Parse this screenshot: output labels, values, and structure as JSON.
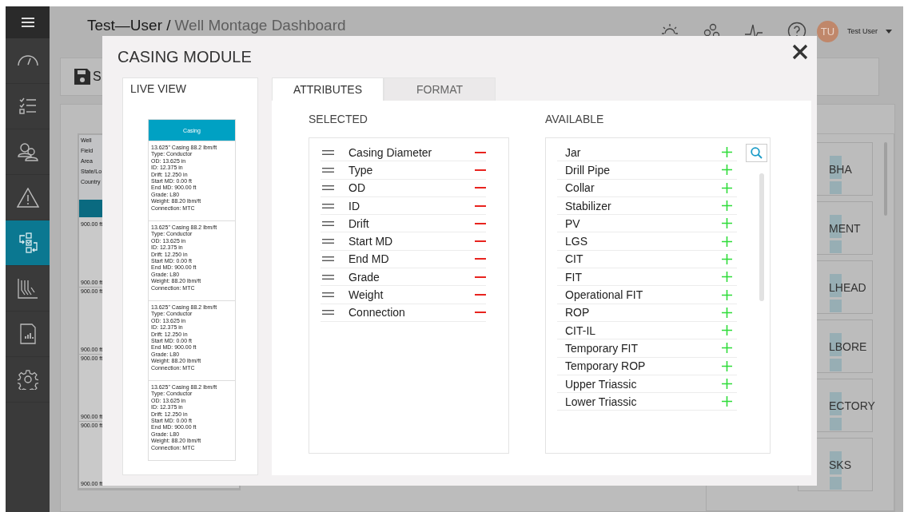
{
  "sidebar": {
    "items": [
      {
        "selected": false
      },
      {
        "selected": false
      },
      {
        "selected": false
      },
      {
        "selected": false
      },
      {
        "selected": true
      },
      {
        "selected": false
      },
      {
        "selected": false
      },
      {
        "selected": false
      }
    ]
  },
  "header": {
    "user": "Test—User /",
    "page": "Well Montage Dashboard",
    "avatar_initials": "TU",
    "user_name": "Test User"
  },
  "toolbar": {
    "save_label": "S"
  },
  "well_info_labels": [
    "Well",
    "Field",
    "Area",
    "State/Lo",
    "Country"
  ],
  "depth_segments": [
    {
      "top": "900.00 ft",
      "bottom": "900.00 ft"
    },
    {
      "top": "900.00 ft",
      "bottom": "900.00 ft"
    },
    {
      "top": "900.00 ft",
      "bottom": "900.00 ft"
    },
    {
      "top": "900.00 ft",
      "bottom": "900.00 ft"
    }
  ],
  "tiles": [
    "BHA",
    "MENT",
    "LHEAD",
    "LBORE",
    "ECTORY",
    "SKS"
  ],
  "modal": {
    "title": "CASING MODULE",
    "live_view": {
      "title": "LIVE VIEW",
      "header": "Casing",
      "cards": [
        [
          "13.625\" Casing 88.2 lbm/ft",
          "Type: Conductor",
          "OD: 13.625 in",
          "ID: 12.375 in",
          "Drift: 12.250 in",
          "Start MD: 0.00 ft",
          "End MD: 900.00 ft",
          "Grade: L80",
          "Weight: 88.20 lbm/ft",
          "Connection: MTC"
        ],
        [
          "13.625\" Casing 88.2 lbm/ft",
          "Type: Conductor",
          "OD: 13.625 in",
          "ID: 12.375 in",
          "Drift: 12.250 in",
          "Start MD: 0.00 ft",
          "End MD: 900.00 ft",
          "Grade: L80",
          "Weight: 88.20 lbm/ft",
          "Connection: MTC"
        ],
        [
          "13.625\" Casing 88.2 lbm/ft",
          "Type: Conductor",
          "OD: 13.625 in",
          "ID: 12.375 in",
          "Drift: 12.250 in",
          "Start MD: 0.00 ft",
          "End MD: 900.00 ft",
          "Grade: L80",
          "Weight: 88.20 lbm/ft",
          "Connection: MTC"
        ],
        [
          "13.625\" Casing 88.2 lbm/ft",
          "Type: Conductor",
          "OD: 13.625 in",
          "ID: 12.375 in",
          "Drift: 12.250 in",
          "Start MD: 0.00 ft",
          "End MD: 900.00 ft",
          "Grade: L80",
          "Weight: 88.20 lbm/ft",
          "Connection: MTC"
        ]
      ]
    },
    "tabs": [
      {
        "label": "ATTRIBUTES",
        "selected": true
      },
      {
        "label": "FORMAT",
        "selected": false
      }
    ],
    "selected": {
      "title": "SELECTED",
      "items": [
        "Casing Diameter",
        "Type",
        "OD",
        "ID",
        "Drift",
        "Start MD",
        "End MD",
        "Grade",
        "Weight",
        "Connection"
      ]
    },
    "available": {
      "title": "AVAILABLE",
      "items": [
        "Jar",
        "Drill Pipe",
        "Collar",
        "Stabilizer",
        "PV",
        "LGS",
        "CIT",
        "FIT",
        "Operational FIT",
        "ROP",
        "CIT-IL",
        "Temporary FIT",
        "Temporary ROP",
        "Upper Triassic",
        "Lower Triassic"
      ]
    }
  }
}
